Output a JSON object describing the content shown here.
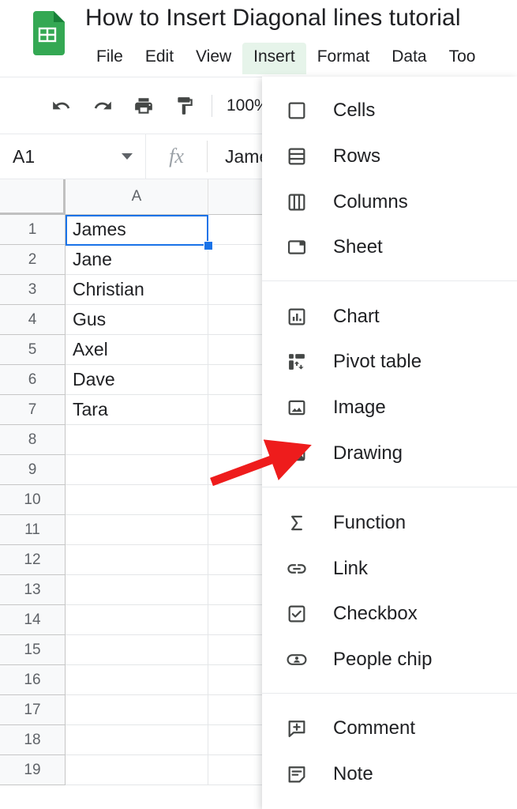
{
  "app": {
    "logo_icon": "google-sheets-logo",
    "doc_title": "How to Insert Diagonal lines tutorial"
  },
  "menubar": {
    "tabs": [
      {
        "label": "File",
        "active": false
      },
      {
        "label": "Edit",
        "active": false
      },
      {
        "label": "View",
        "active": false
      },
      {
        "label": "Insert",
        "active": true
      },
      {
        "label": "Format",
        "active": false
      },
      {
        "label": "Data",
        "active": false
      },
      {
        "label": "Too",
        "active": false
      }
    ],
    "active_highlight_color": "#e6f4ea"
  },
  "toolbar": {
    "icons": [
      {
        "name": "undo-icon"
      },
      {
        "name": "redo-icon"
      },
      {
        "name": "print-icon"
      },
      {
        "name": "paint-format-icon"
      }
    ],
    "zoom_value": "100%"
  },
  "formula_bar": {
    "name_box_value": "A1",
    "fx_label": "fx",
    "formula_value": "James"
  },
  "grid": {
    "columns": [
      {
        "label": "A"
      },
      {
        "label": ""
      }
    ],
    "rows": [
      "1",
      "2",
      "3",
      "4",
      "5",
      "6",
      "7",
      "8",
      "9",
      "10",
      "11",
      "12",
      "13",
      "14",
      "15",
      "16",
      "17",
      "18",
      "19"
    ],
    "cells_column_a": [
      "James",
      "Jane",
      "Christian",
      "Gus",
      "Axel",
      "Dave",
      "Tara",
      "",
      "",
      "",
      "",
      "",
      "",
      "",
      "",
      "",
      "",
      "",
      ""
    ],
    "selected_cell": "A1",
    "selection_color": "#1a73e8"
  },
  "insert_menu": {
    "groups": [
      {
        "items": [
          {
            "label": "Cells",
            "icon": "cells-icon"
          },
          {
            "label": "Rows",
            "icon": "rows-icon"
          },
          {
            "label": "Columns",
            "icon": "columns-icon"
          },
          {
            "label": "Sheet",
            "icon": "sheet-icon"
          }
        ]
      },
      {
        "items": [
          {
            "label": "Chart",
            "icon": "chart-icon"
          },
          {
            "label": "Pivot table",
            "icon": "pivot-table-icon"
          },
          {
            "label": "Image",
            "icon": "image-icon"
          },
          {
            "label": "Drawing",
            "icon": "drawing-icon"
          }
        ]
      },
      {
        "items": [
          {
            "label": "Function",
            "icon": "function-sigma-icon"
          },
          {
            "label": "Link",
            "icon": "link-icon"
          },
          {
            "label": "Checkbox",
            "icon": "checkbox-icon"
          },
          {
            "label": "People chip",
            "icon": "people-chip-icon"
          }
        ]
      },
      {
        "items": [
          {
            "label": "Comment",
            "icon": "comment-plus-icon"
          },
          {
            "label": "Note",
            "icon": "note-icon"
          }
        ]
      }
    ]
  },
  "annotation": {
    "arrow_color": "#ee1c1c",
    "points_to": "Drawing"
  }
}
